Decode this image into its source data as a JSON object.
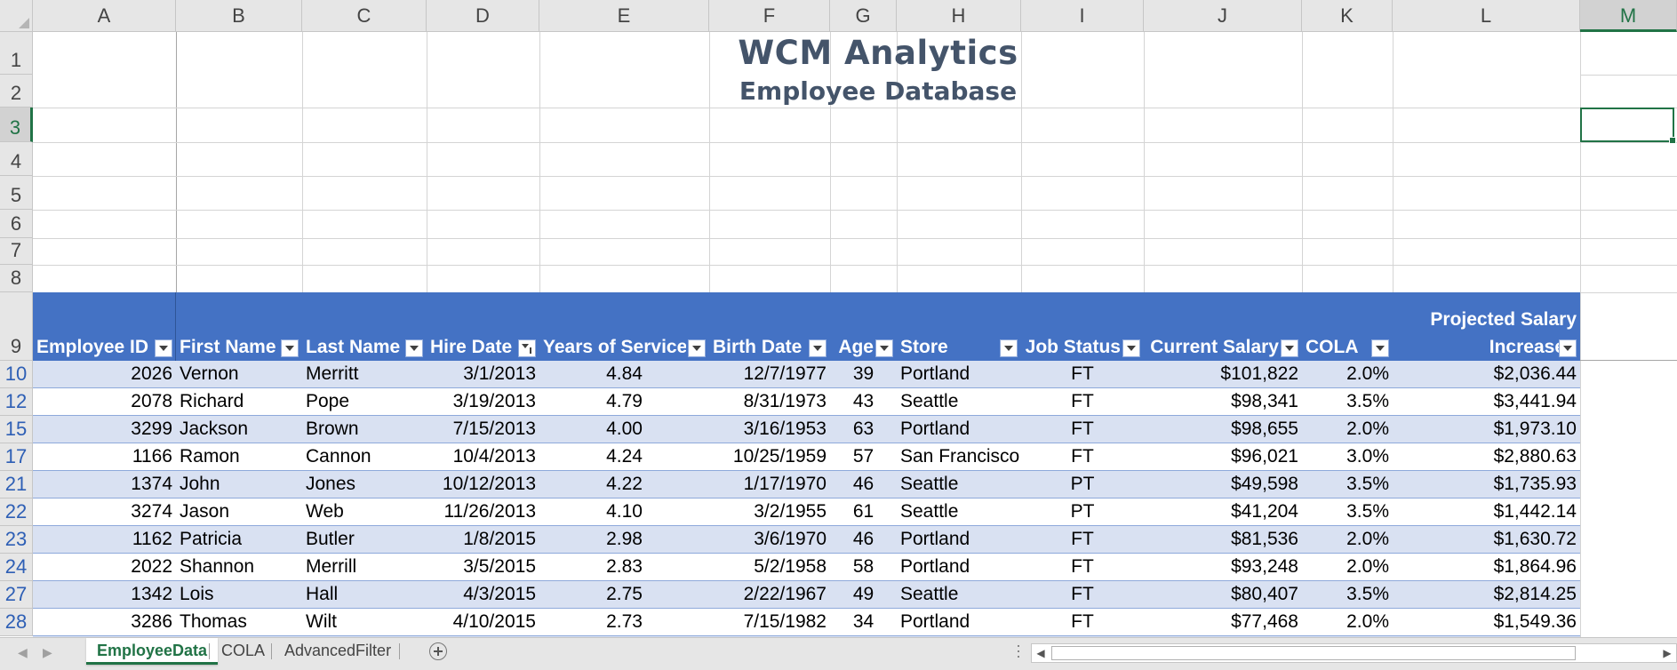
{
  "app": "Microsoft Excel",
  "columns": [
    "A",
    "B",
    "C",
    "D",
    "E",
    "F",
    "G",
    "H",
    "I",
    "J",
    "K",
    "L",
    "M"
  ],
  "selected_column": "M",
  "selected_row": "3",
  "row_numbers_top": [
    "1",
    "2",
    "3",
    "4",
    "5",
    "6",
    "7",
    "8",
    "9"
  ],
  "title": "WCM Analytics",
  "subtitle": "Employee Database",
  "headers": {
    "employee_id": "Employee ID",
    "first_name": "First Name",
    "last_name": "Last Name",
    "hire_date": "Hire Date",
    "years_of_service": "Years of Service",
    "birth_date": "Birth Date",
    "age": "Age",
    "store": "Store",
    "job_status": "Job Status",
    "current_salary": "Current Salary",
    "cola": "COLA",
    "projected_line1": "Projected Salary",
    "projected_line2": "Increase"
  },
  "rows": [
    {
      "row": "10",
      "id": "2026",
      "first": "Vernon",
      "last": "Merritt",
      "hire": "3/1/2013",
      "yos": "4.84",
      "birth": "12/7/1977",
      "age": "39",
      "store": "Portland",
      "status": "FT",
      "salary": "$101,822",
      "cola": "2.0%",
      "proj": "$2,036.44"
    },
    {
      "row": "12",
      "id": "2078",
      "first": "Richard",
      "last": "Pope",
      "hire": "3/19/2013",
      "yos": "4.79",
      "birth": "8/31/1973",
      "age": "43",
      "store": "Seattle",
      "status": "FT",
      "salary": "$98,341",
      "cola": "3.5%",
      "proj": "$3,441.94"
    },
    {
      "row": "15",
      "id": "3299",
      "first": "Jackson",
      "last": "Brown",
      "hire": "7/15/2013",
      "yos": "4.00",
      "birth": "3/16/1953",
      "age": "63",
      "store": "Portland",
      "status": "FT",
      "salary": "$98,655",
      "cola": "2.0%",
      "proj": "$1,973.10"
    },
    {
      "row": "17",
      "id": "1166",
      "first": "Ramon",
      "last": "Cannon",
      "hire": "10/4/2013",
      "yos": "4.24",
      "birth": "10/25/1959",
      "age": "57",
      "store": "San Francisco",
      "status": "FT",
      "salary": "$96,021",
      "cola": "3.0%",
      "proj": "$2,880.63"
    },
    {
      "row": "21",
      "id": "1374",
      "first": "John",
      "last": "Jones",
      "hire": "10/12/2013",
      "yos": "4.22",
      "birth": "1/17/1970",
      "age": "46",
      "store": "Seattle",
      "status": "PT",
      "salary": "$49,598",
      "cola": "3.5%",
      "proj": "$1,735.93"
    },
    {
      "row": "22",
      "id": "3274",
      "first": "Jason",
      "last": "Web",
      "hire": "11/26/2013",
      "yos": "4.10",
      "birth": "3/2/1955",
      "age": "61",
      "store": "Seattle",
      "status": "PT",
      "salary": "$41,204",
      "cola": "3.5%",
      "proj": "$1,442.14"
    },
    {
      "row": "23",
      "id": "1162",
      "first": "Patricia",
      "last": "Butler",
      "hire": "1/8/2015",
      "yos": "2.98",
      "birth": "3/6/1970",
      "age": "46",
      "store": "Portland",
      "status": "FT",
      "salary": "$81,536",
      "cola": "2.0%",
      "proj": "$1,630.72"
    },
    {
      "row": "24",
      "id": "2022",
      "first": "Shannon",
      "last": "Merrill",
      "hire": "3/5/2015",
      "yos": "2.83",
      "birth": "5/2/1958",
      "age": "58",
      "store": "Portland",
      "status": "FT",
      "salary": "$93,248",
      "cola": "2.0%",
      "proj": "$1,864.96"
    },
    {
      "row": "27",
      "id": "1342",
      "first": "Lois",
      "last": "Hall",
      "hire": "4/3/2015",
      "yos": "2.75",
      "birth": "2/22/1967",
      "age": "49",
      "store": "Seattle",
      "status": "FT",
      "salary": "$80,407",
      "cola": "3.5%",
      "proj": "$2,814.25"
    },
    {
      "row": "28",
      "id": "3286",
      "first": "Thomas",
      "last": "Wilt",
      "hire": "4/10/2015",
      "yos": "2.73",
      "birth": "7/15/1982",
      "age": "34",
      "store": "Portland",
      "status": "FT",
      "salary": "$77,468",
      "cola": "2.0%",
      "proj": "$1,549.36"
    }
  ],
  "sheet_tabs": [
    {
      "label": "EmployeeData",
      "active": true
    },
    {
      "label": "COLA",
      "active": false
    },
    {
      "label": "AdvancedFilter",
      "active": false
    }
  ],
  "colors": {
    "accent": "#217346",
    "table_header": "#4472c4",
    "band": "#d9e1f2",
    "title": "#44546a",
    "filtered_row": "#2e5fb5"
  }
}
